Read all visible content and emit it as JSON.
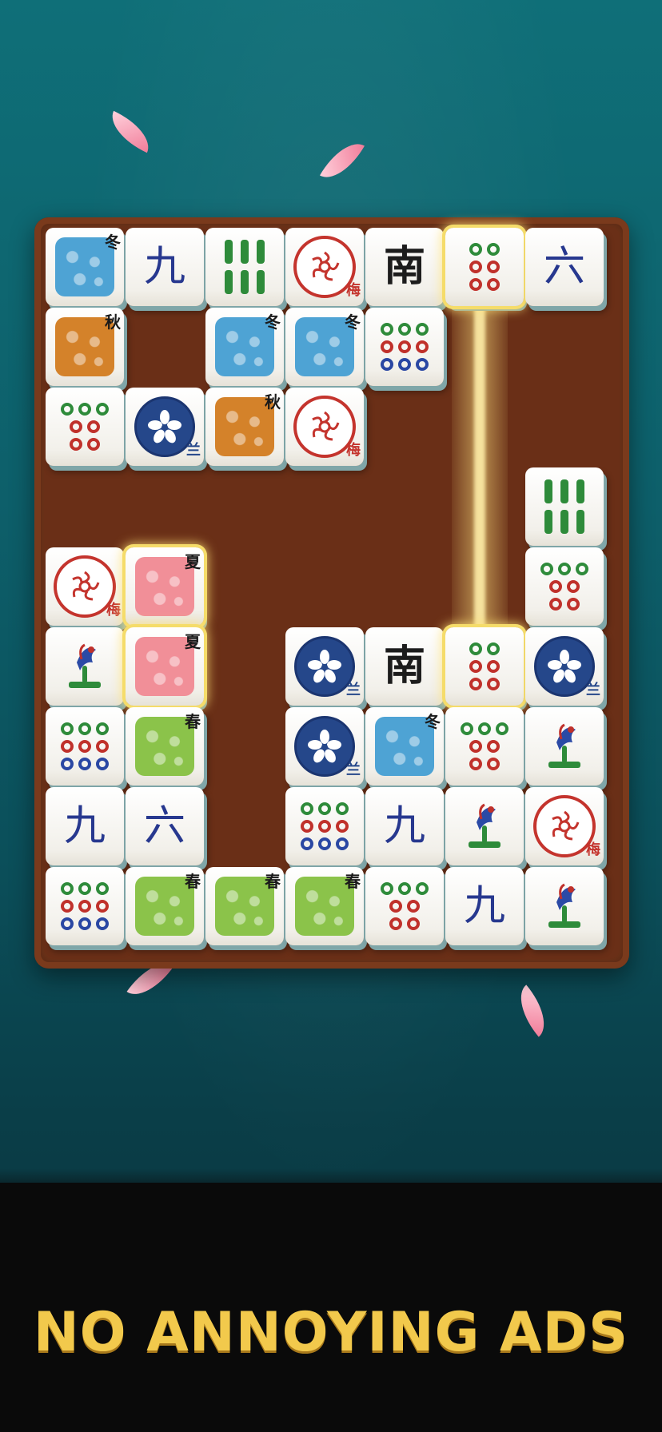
{
  "headline": "NO ANNOYING ADS",
  "colors": {
    "gold_text": "#f2c94c",
    "board": "#6e3319",
    "background": "#0d5f6a"
  },
  "tiles_icons": {
    "season_winter": "冬",
    "season_autumn": "秋",
    "season_summer": "夏",
    "season_spring": "春",
    "flower_plum": "梅",
    "flower_orchid": "兰",
    "char_nine": "九",
    "char_six": "六",
    "wind_south": "南"
  },
  "tiles": [
    {
      "t": "season",
      "v": "冬",
      "k": "winter"
    },
    {
      "t": "char",
      "v": "九"
    },
    {
      "t": "bamboo"
    },
    {
      "t": "plum",
      "v": "梅"
    },
    {
      "t": "wind",
      "v": "南"
    },
    {
      "t": "dots6",
      "sel": true
    },
    {
      "t": "char",
      "v": "六"
    },
    {
      "t": "season",
      "v": "秋",
      "k": "autumn"
    },
    {
      "t": "season",
      "v": "冬",
      "k": "winter"
    },
    {
      "t": "season",
      "v": "冬",
      "k": "winter"
    },
    {
      "t": "dots9"
    },
    {
      "t": "dots7"
    },
    {
      "t": "orchid",
      "v": "兰"
    },
    {
      "t": "season",
      "v": "秋",
      "k": "autumn"
    },
    {
      "t": "plum",
      "v": "梅"
    },
    {
      "t": "bamboo"
    },
    {
      "t": "dots7"
    },
    {
      "t": "plum",
      "v": "梅"
    },
    {
      "t": "season",
      "v": "夏",
      "k": "summer",
      "sel": true
    },
    {
      "t": "bird"
    },
    {
      "t": "season",
      "v": "夏",
      "k": "summer",
      "sel": true
    },
    {
      "t": "orchid",
      "v": "兰"
    },
    {
      "t": "wind",
      "v": "南"
    },
    {
      "t": "dots6",
      "sel": true
    },
    {
      "t": "orchid",
      "v": "兰"
    },
    {
      "t": "dots9"
    },
    {
      "t": "season",
      "v": "春",
      "k": "spring"
    },
    {
      "t": "orchid",
      "v": "兰"
    },
    {
      "t": "season",
      "v": "冬",
      "k": "winter"
    },
    {
      "t": "dots7"
    },
    {
      "t": "bird"
    },
    {
      "t": "char",
      "v": "九"
    },
    {
      "t": "char",
      "v": "六"
    },
    {
      "t": "dots9"
    },
    {
      "t": "char",
      "v": "九"
    },
    {
      "t": "bird"
    },
    {
      "t": "plum",
      "v": "梅"
    },
    {
      "t": "dots9"
    },
    {
      "t": "season",
      "v": "春",
      "k": "spring"
    },
    {
      "t": "season",
      "v": "春",
      "k": "spring"
    },
    {
      "t": "season",
      "v": "春",
      "k": "spring"
    },
    {
      "t": "dots7"
    },
    {
      "t": "char",
      "v": "九"
    },
    {
      "t": "bird"
    }
  ]
}
